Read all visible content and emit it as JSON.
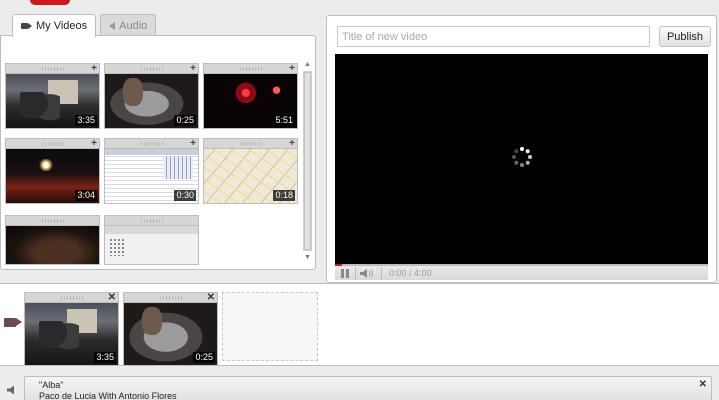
{
  "library": {
    "tabs": [
      {
        "label": "My Videos",
        "icon": "video-camera-icon",
        "active": true
      },
      {
        "label": "Audio",
        "icon": "speaker-icon",
        "active": false
      }
    ],
    "clips": [
      {
        "duration": "3:35",
        "scene": "street"
      },
      {
        "duration": "0:25",
        "scene": "drummer"
      },
      {
        "duration": "5:51",
        "scene": "fireworks"
      },
      {
        "duration": "3:04",
        "scene": "crowd-night"
      },
      {
        "duration": "0:30",
        "scene": "spreadsheet-screen"
      },
      {
        "duration": "0:18",
        "scene": "map"
      },
      {
        "duration": "",
        "scene": "dark-room"
      },
      {
        "duration": "",
        "scene": "web-page"
      }
    ]
  },
  "player": {
    "title_placeholder": "Title of new video",
    "publish_label": "Publish",
    "timecode": "0:00 / 4:00",
    "progress": 0.02
  },
  "timeline": {
    "clips": [
      {
        "duration": "3:35",
        "scene": "street"
      },
      {
        "duration": "0:25",
        "scene": "drummer"
      }
    ]
  },
  "audio": {
    "title": "\"Alba\"",
    "artist": "Paco de Lucia With Antonio Flores"
  },
  "colors": {
    "brand_red": "#cc181e",
    "panel_border": "#bdbdbd",
    "background": "#ececec"
  }
}
